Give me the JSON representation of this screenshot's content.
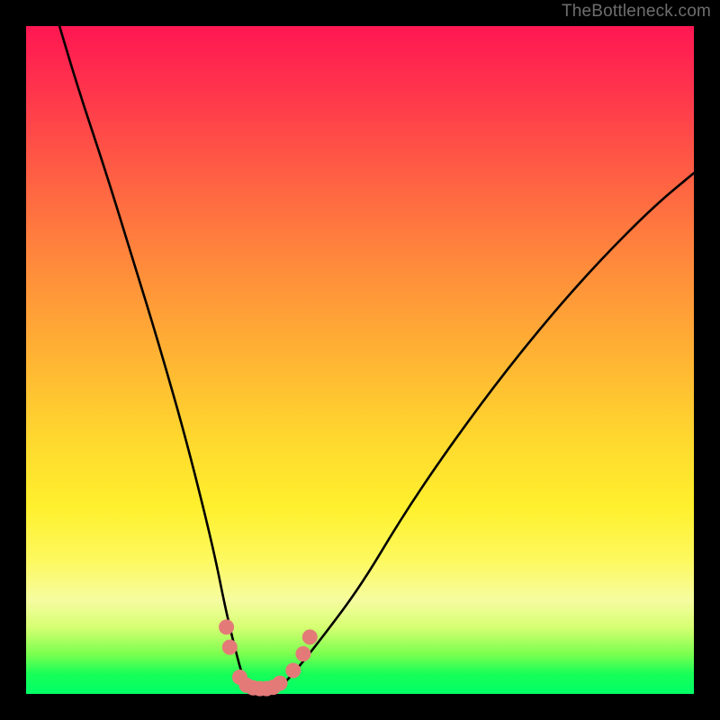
{
  "watermark": "TheBottleneck.com",
  "chart_data": {
    "type": "line",
    "title": "",
    "xlabel": "",
    "ylabel": "",
    "xlim": [
      0,
      100
    ],
    "ylim": [
      0,
      100
    ],
    "gradient_meaning": "bottom green = best match (0%), top red = worst (100%)",
    "series": [
      {
        "name": "bottleneck-curve",
        "x": [
          5,
          8,
          12,
          16,
          20,
          24,
          28,
          30,
          32,
          33,
          34,
          36,
          38,
          40,
          44,
          50,
          56,
          62,
          70,
          78,
          86,
          94,
          100
        ],
        "y": [
          100,
          90,
          78,
          65,
          52,
          38,
          22,
          12,
          4,
          1,
          0,
          0,
          1,
          3,
          8,
          16,
          26,
          35,
          46,
          56,
          65,
          73,
          78
        ]
      }
    ],
    "markers": {
      "name": "highlighted-points",
      "color": "#e47a78",
      "points": [
        {
          "x": 30,
          "y": 10
        },
        {
          "x": 30.5,
          "y": 7
        },
        {
          "x": 32,
          "y": 2.5
        },
        {
          "x": 33,
          "y": 1.3
        },
        {
          "x": 34,
          "y": 0.9
        },
        {
          "x": 35,
          "y": 0.8
        },
        {
          "x": 36,
          "y": 0.8
        },
        {
          "x": 37,
          "y": 1
        },
        {
          "x": 38,
          "y": 1.6
        },
        {
          "x": 40,
          "y": 3.5
        },
        {
          "x": 41.5,
          "y": 6
        },
        {
          "x": 42.5,
          "y": 8.5
        }
      ]
    }
  }
}
